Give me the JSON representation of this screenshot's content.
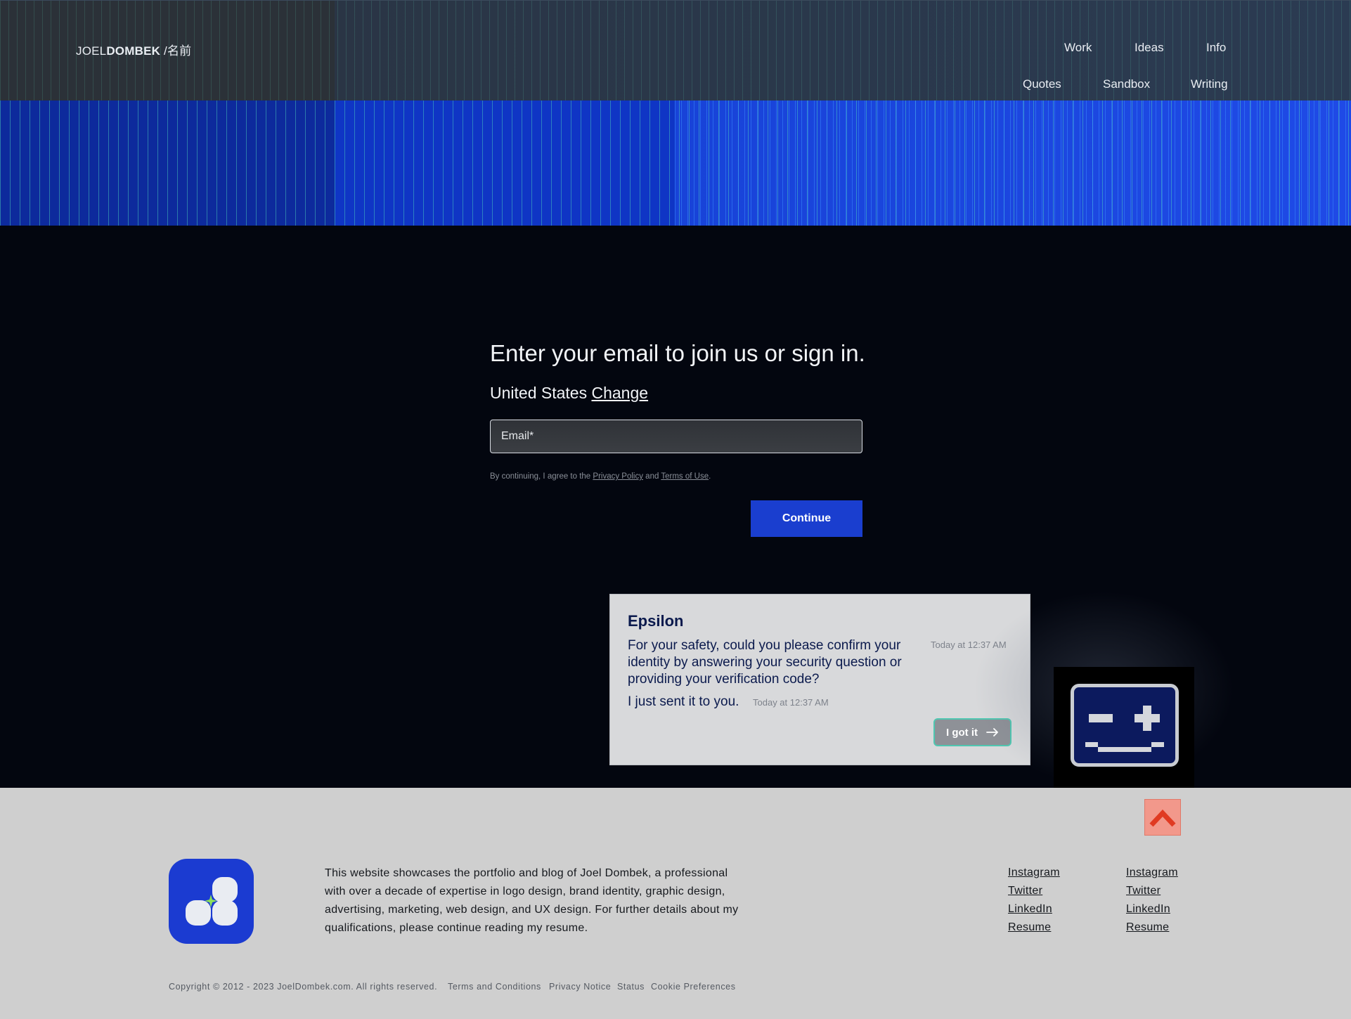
{
  "header": {
    "brand_first": "JOEL",
    "brand_last": "DOMBEK",
    "brand_suffix": " /名前",
    "nav": [
      "Work",
      "Ideas",
      "Info",
      "Quotes",
      "Sandbox",
      "Writing"
    ]
  },
  "signin": {
    "title": "Enter your email to join us or sign in.",
    "country": "United States",
    "change_label": "Change",
    "email_placeholder": "Email*",
    "legal_prefix": "By continuing, I agree to the ",
    "privacy_label": "Privacy Policy",
    "legal_and": " and ",
    "terms_label": "Terms of Use",
    "legal_suffix": ".",
    "continue_label": "Continue",
    "accent_color": "#1a3ecf"
  },
  "chat": {
    "name": "Epsilon",
    "message1": "For your safety, could you please confirm your identity by answering your security question or providing your verification code?",
    "time1": "Today at 12:37 AM",
    "message2": "I just sent it to you.",
    "time2": "Today at 12:37 AM",
    "button_label": "I got it"
  },
  "footer": {
    "about": "This website showcases the portfolio and blog of Joel Dombek, a professional with over a decade of expertise in logo design, brand identity, graphic design, advertising, marketing, web design, and UX design. For further details about my qualifications, please continue reading my resume.",
    "links_col1": [
      "Instagram",
      "Twitter",
      "LinkedIn",
      "Resume"
    ],
    "links_col2": [
      "Instagram",
      "Twitter",
      "LinkedIn",
      "Resume"
    ],
    "copyright": "Copyright © 2012 - 2023 JoelDombek.com. All rights reserved.",
    "bottom_links": [
      "Terms and Conditions",
      "Privacy Notice",
      "Status",
      "Cookie Preferences"
    ]
  },
  "icons": {
    "logo": "clover-logo-icon",
    "to_top": "chevron-up-icon",
    "robot": "robot-face-icon",
    "arrow": "arrow-right-icon"
  }
}
